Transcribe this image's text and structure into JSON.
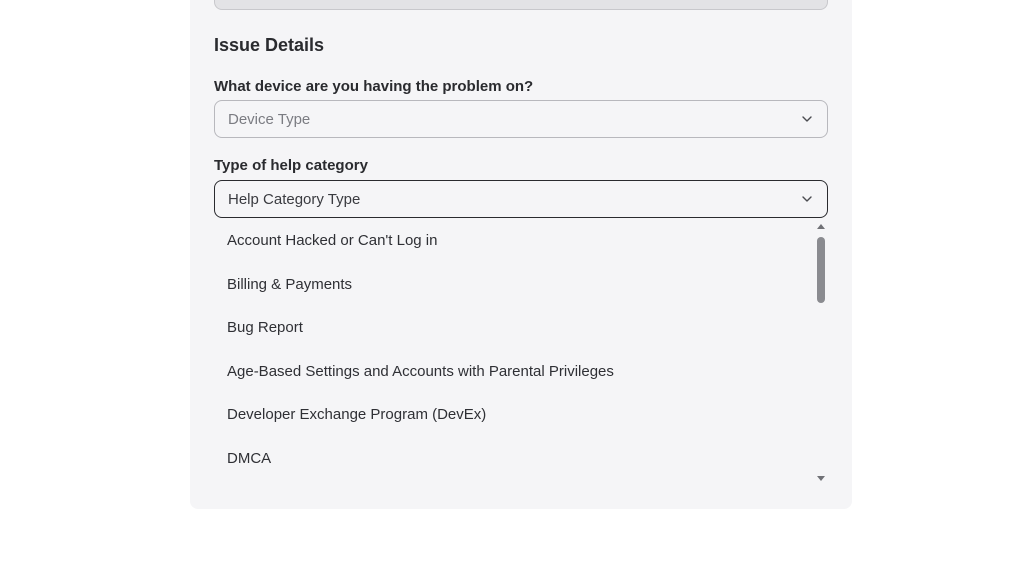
{
  "section": {
    "title": "Issue Details"
  },
  "device_field": {
    "label": "What device are you having the problem on?",
    "placeholder": "Device Type"
  },
  "category_field": {
    "label": "Type of help category",
    "placeholder": "Help Category Type"
  },
  "category_options": [
    "Account Hacked or Can't Log in",
    "Billing & Payments",
    "Bug Report",
    "Age-Based Settings and Accounts with Parental Privileges",
    "Developer Exchange Program (DevEx)",
    "DMCA"
  ],
  "icons": {
    "select_chevron": "chevron-down-icon",
    "scroll_up": "scroll-up-arrow-icon",
    "scroll_down": "scroll-down-arrow-icon"
  },
  "colors": {
    "panel_background": "#f5f5f7",
    "active_border": "#2a2b2f",
    "scroll_thumb": "#8a8b90"
  }
}
